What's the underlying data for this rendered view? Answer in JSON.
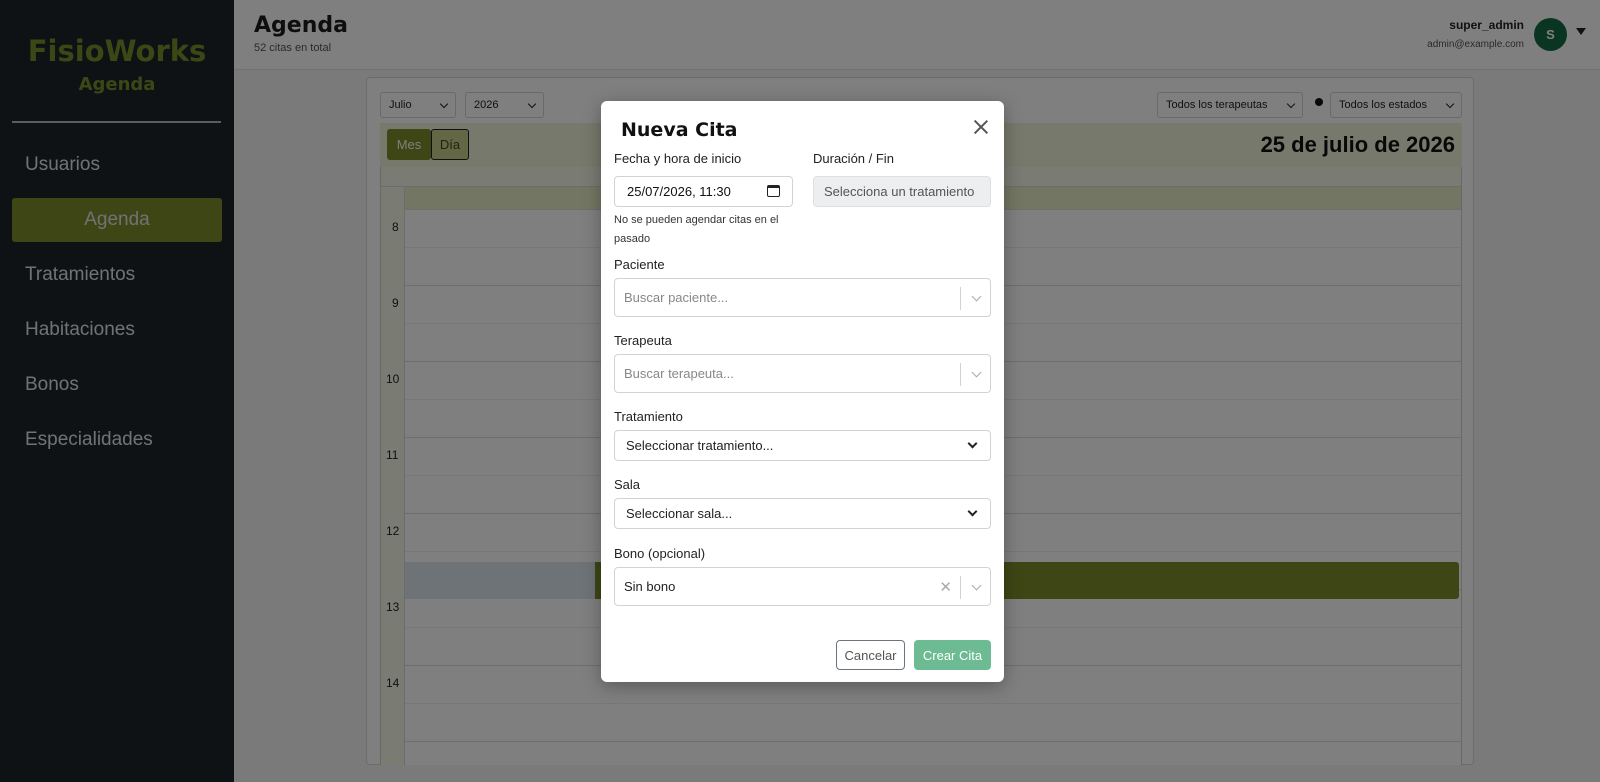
{
  "sidebar": {
    "brand": "FisioWorks",
    "subtitle": "Agenda",
    "items": [
      {
        "label": "Usuarios"
      },
      {
        "label": "Agenda",
        "active": true
      },
      {
        "label": "Tratamientos"
      },
      {
        "label": "Habitaciones"
      },
      {
        "label": "Bonos"
      },
      {
        "label": "Especialidades"
      }
    ]
  },
  "header": {
    "title": "Agenda",
    "subtitle": "52 citas en total",
    "user_name": "super_admin",
    "user_email": "admin@example.com",
    "avatar_initial": "S"
  },
  "calendar": {
    "month_select": "Julio",
    "year_select": "2026",
    "therapist_filter": "Todos los terapeutas",
    "status_filter": "Todos los estados",
    "view_month": "Mes",
    "view_day": "Día",
    "date_title": "25 de julio de 2026",
    "hours": [
      "8",
      "9",
      "10",
      "11",
      "12",
      "13",
      "14"
    ]
  },
  "modal": {
    "title": "Nueva Cita",
    "start_label": "Fecha y hora de inicio",
    "start_value": "25/07/2026, 11:30",
    "start_help": "No se pueden agendar citas en el pasado",
    "duration_label": "Duración / Fin",
    "duration_value": "Selecciona un tratamiento",
    "patient_label": "Paciente",
    "patient_placeholder": "Buscar paciente...",
    "therapist_label": "Terapeuta",
    "therapist_placeholder": "Buscar terapeuta...",
    "treatment_label": "Tratamiento",
    "treatment_value": "Seleccionar tratamiento...",
    "room_label": "Sala",
    "room_value": "Seleccionar sala...",
    "bono_label": "Bono (opcional)",
    "bono_value": "Sin bono",
    "cancel_label": "Cancelar",
    "create_label": "Crear Cita"
  },
  "colors": {
    "brand": "#7d8c2a",
    "sidebar_bg": "#1f2428",
    "avatar": "#156b46",
    "create_button": "#6dbb92"
  }
}
